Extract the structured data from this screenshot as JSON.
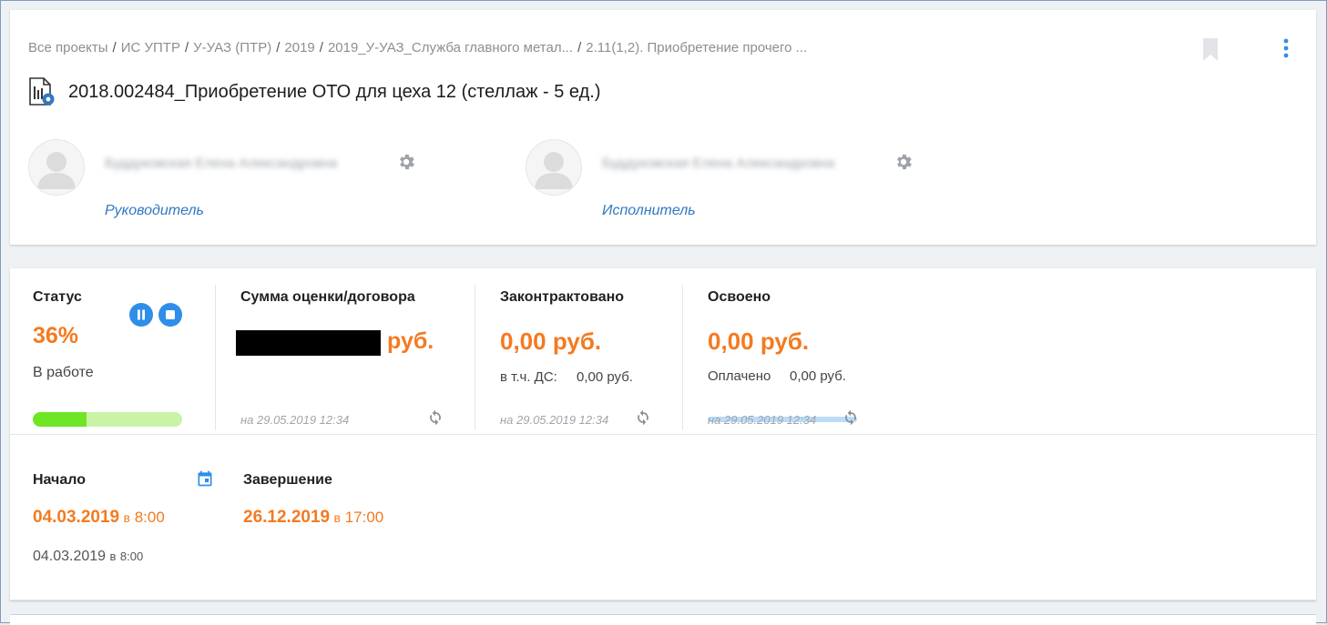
{
  "breadcrumb": {
    "items": [
      "Все проекты",
      "ИС УПТР",
      "У-УАЗ (ПТР)",
      "2019",
      "2019_У-УАЗ_Служба главного метал...",
      "2.11(1,2). Приобретение прочего ..."
    ],
    "separator": "/"
  },
  "header": {
    "title": "2018.002484_Приобретение ОТО для цеха 12 (стеллаж - 5 ед.)",
    "icons": [
      "document-chart-icon",
      "bookmark-icon",
      "more-vertical-icon"
    ]
  },
  "people": [
    {
      "name": "Буддуковская Елена Александровна",
      "role": "Руководитель"
    },
    {
      "name": "Буддуковская Елена Александровна",
      "role": "Исполнитель"
    }
  ],
  "metrics": {
    "status": {
      "label": "Статус",
      "value": "36%",
      "state": "В работе",
      "progress": 0.36
    },
    "estimate": {
      "label": "Сумма оценки/договора",
      "value_suffix": "руб.",
      "date": "на 29.05.2019 12:34"
    },
    "contracted": {
      "label": "Законтрактовано",
      "value": "0,00 руб.",
      "sub_label": "в т.ч. ДС:",
      "sub_value": "0,00 руб.",
      "date": "на 29.05.2019 12:34"
    },
    "mastered": {
      "label": "Освоено",
      "value": "0,00 руб.",
      "sub_label": "Оплачено",
      "sub_value": "0,00 руб.",
      "paid_fraction": 0.0,
      "date": "на 29.05.2019 12:34"
    }
  },
  "dates": {
    "start": {
      "label": "Начало",
      "date": "04.03.2019",
      "pre": "в",
      "time": "8:00",
      "actual_date": "04.03.2019",
      "actual_time": "8:00"
    },
    "end": {
      "label": "Завершение",
      "date": "26.12.2019",
      "pre": "в",
      "time": "17:00"
    }
  },
  "colors": {
    "accent_orange": "#f47a20",
    "link_blue": "#2f78c2",
    "control_blue": "#2f8ee9",
    "progress_green": "#6ee626",
    "progress_track": "#c9f3a6"
  }
}
